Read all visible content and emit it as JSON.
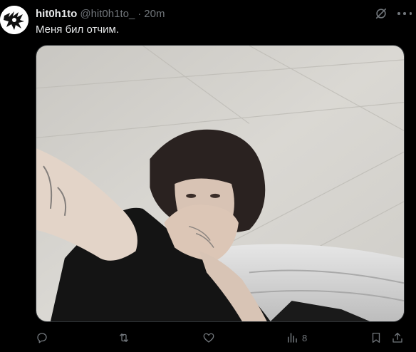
{
  "tweet": {
    "author": {
      "display_name": "hit0h1to",
      "handle": "@hit0h1to_",
      "separator": "·",
      "time": "20m"
    },
    "text": "Меня бил отчим.",
    "media": {
      "description_icon": "photo"
    },
    "actions": {
      "reply": {
        "icon": "reply-icon"
      },
      "retweet": {
        "icon": "retweet-icon"
      },
      "like": {
        "icon": "heart-icon"
      },
      "views": {
        "icon": "views-icon",
        "count": "8"
      },
      "bookmark": {
        "icon": "bookmark-icon"
      },
      "share": {
        "icon": "share-icon"
      }
    }
  },
  "colors": {
    "background": "#000000",
    "text_primary": "#e7e9ea",
    "text_secondary": "#71767b",
    "border": "#2f3336"
  }
}
